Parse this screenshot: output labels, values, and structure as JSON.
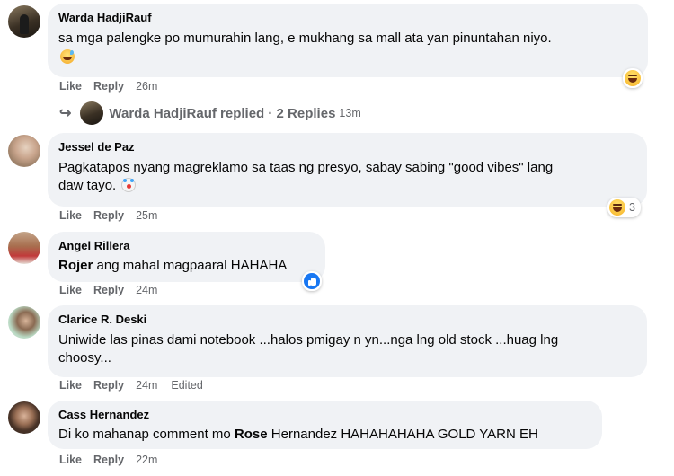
{
  "actions": {
    "like": "Like",
    "reply": "Reply"
  },
  "comments": [
    {
      "author": "Warda HadjiRauf",
      "text": "sa mga palengke po mumurahin lang, e mukhang sa mall ata yan pinuntahan niyo.",
      "inline_emoji": "grinning-sweat-emoji",
      "time": "26m",
      "reaction": {
        "icon": "haha-reaction-icon",
        "count": ""
      }
    },
    {
      "author": "Jessel de Paz",
      "text_line1": "Pagkatapos nyang magreklamo sa taas ng presyo, sabay sabing \"good vibes\" lang",
      "text_line2": "daw tayo.",
      "inline_emoji": "clown-emoji",
      "time": "25m",
      "reaction": {
        "icon": "haha-reaction-icon",
        "count": "3"
      }
    },
    {
      "author": "Angel Rillera",
      "mention": "Rojer",
      "text": " ang mahal magpaaral HAHAHA",
      "time": "24m",
      "reaction": {
        "icon": "like-reaction-icon",
        "count": ""
      }
    },
    {
      "author": "Clarice R. Deski",
      "text_line1": "Uniwide las pinas dami notebook ...halos pmigay n yn...nga lng old stock ...huag lng",
      "text_line2": "choosy...",
      "time": "24m",
      "edited": "Edited"
    },
    {
      "author": "Cass Hernandez",
      "text_before": "Di ko mahanap comment mo ",
      "mention": "Rose",
      "text_after": " Hernandez HAHAHAHAHA GOLD YARN EH",
      "time": "22m"
    }
  ],
  "replies_row": {
    "label": "Warda HadjiRauf replied · 2 Replies",
    "time": "13m"
  }
}
